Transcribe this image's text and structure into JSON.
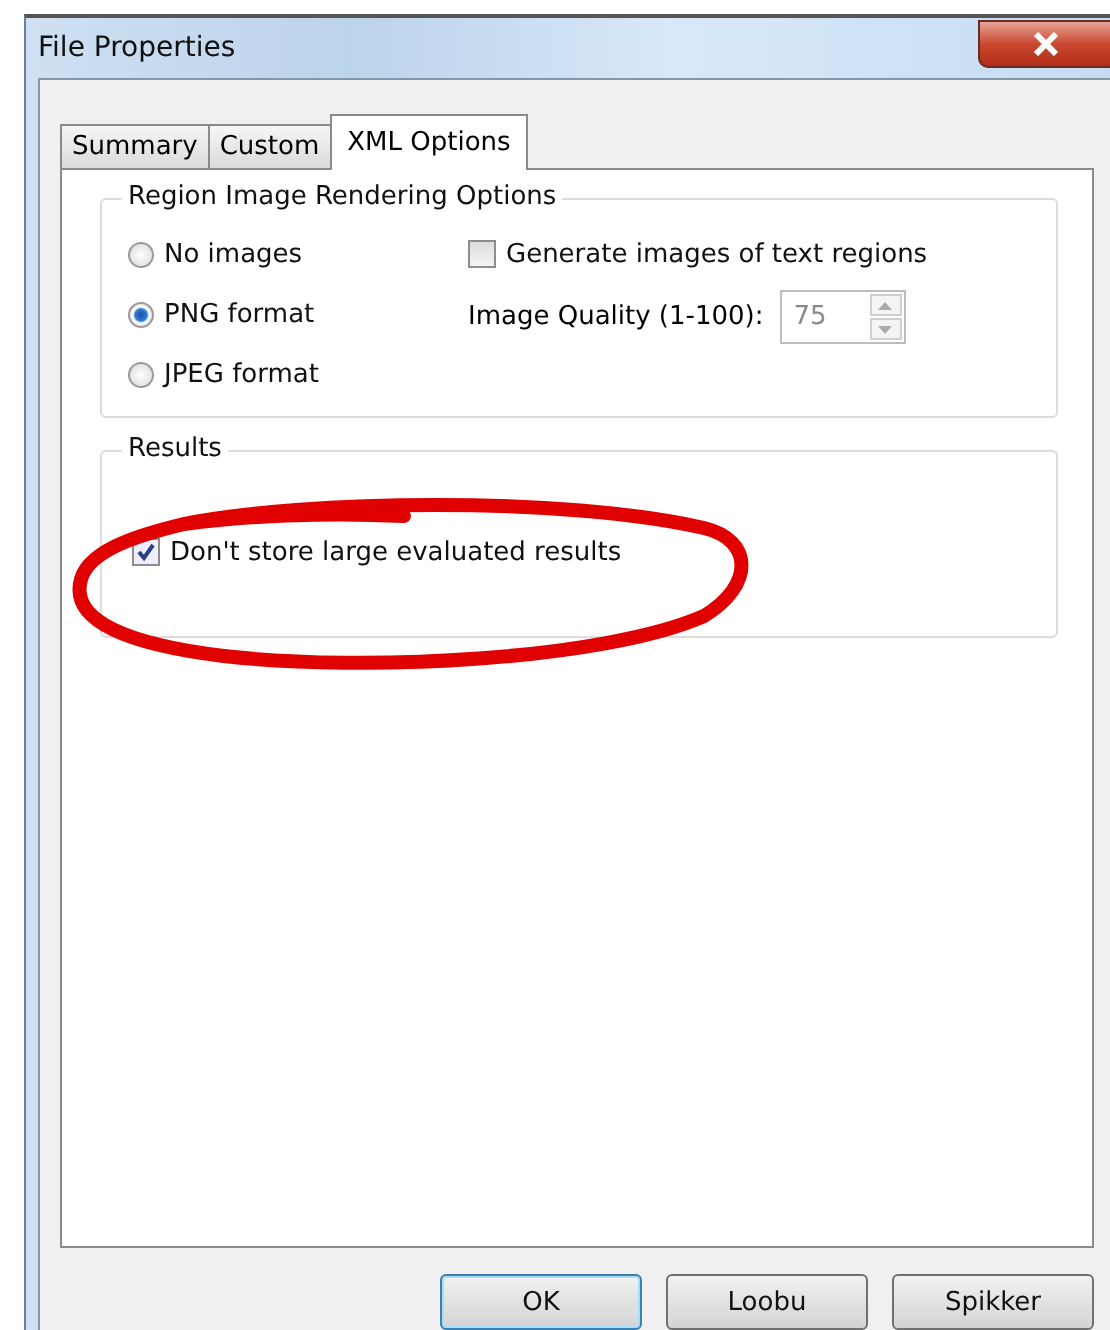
{
  "window": {
    "title": "File Properties"
  },
  "tabs": [
    {
      "label": "Summary",
      "selected": false
    },
    {
      "label": "Custom",
      "selected": false
    },
    {
      "label": "XML Options",
      "selected": true
    }
  ],
  "rendering_group": {
    "title": "Region Image Rendering Options",
    "formats": [
      {
        "label": "No images",
        "selected": false
      },
      {
        "label": "PNG format",
        "selected": true
      },
      {
        "label": "JPEG format",
        "selected": false
      }
    ],
    "generate_text_regions": {
      "label": "Generate images of text regions",
      "checked": false
    },
    "image_quality": {
      "label": "Image Quality (1-100):",
      "value": "75",
      "disabled": true
    }
  },
  "results_group": {
    "title": "Results",
    "dont_store_large": {
      "label": "Don't store large evaluated results",
      "checked": true
    }
  },
  "annotation": {
    "kind": "ellipse"
  },
  "buttons": [
    {
      "label": "OK",
      "default": true
    },
    {
      "label": "Loobu",
      "default": false
    },
    {
      "label": "Spikker",
      "default": false
    }
  ]
}
